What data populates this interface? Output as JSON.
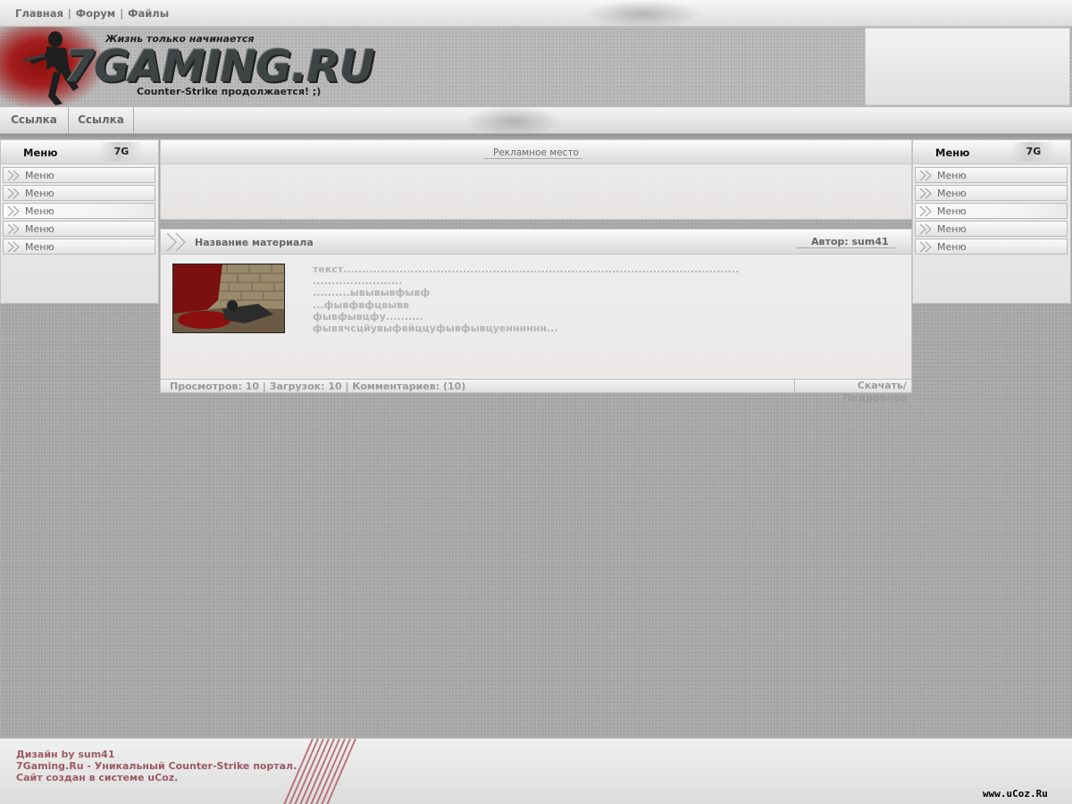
{
  "top_nav": {
    "items": [
      "Главная",
      "Форум",
      "Файлы"
    ],
    "separator": "|"
  },
  "header": {
    "slogan": "Жизнь только начинается",
    "logo_text": "7GAMING.RU",
    "subtitle": "Counter-Strike продолжается! ;)"
  },
  "nav": {
    "links": [
      "Ссылка",
      "Ссылка"
    ]
  },
  "left_menu": {
    "title": "Меню",
    "tag": "7G",
    "items": [
      "Меню",
      "Меню",
      "Меню",
      "Меню",
      "Меню"
    ]
  },
  "right_menu": {
    "title": "Меню",
    "tag": "7G",
    "items": [
      "Меню",
      "Меню",
      "Меню",
      "Меню",
      "Меню"
    ]
  },
  "ad": {
    "label": "Рекламное место"
  },
  "post": {
    "title": "Название материала",
    "author": "Автор: sum41",
    "body_lines": [
      "текст..........................................................................................................",
      "........................",
      "..........ывывывфывф",
      "...фывфвфцвывв",
      "фывфывцфу..........",
      "фывячсцйувыфвйццуфывфывцуенннннн..."
    ],
    "stats": "Просмотров: 10 | Загрузок: 10 | Комментариев: (10)",
    "more": "Скачать/Подробнее"
  },
  "footer": {
    "lines": [
      "Дизайн by sum41",
      "7Gaming.Ru - Уникальный Counter-Strike портал.",
      "Сайт создан в системе uCoz."
    ],
    "badge": "www.uCoz.Ru"
  },
  "colors": {
    "page_bg": "#a9a9a9",
    "footer_text": "#9c5a63",
    "blood_red": "#8b1010"
  }
}
